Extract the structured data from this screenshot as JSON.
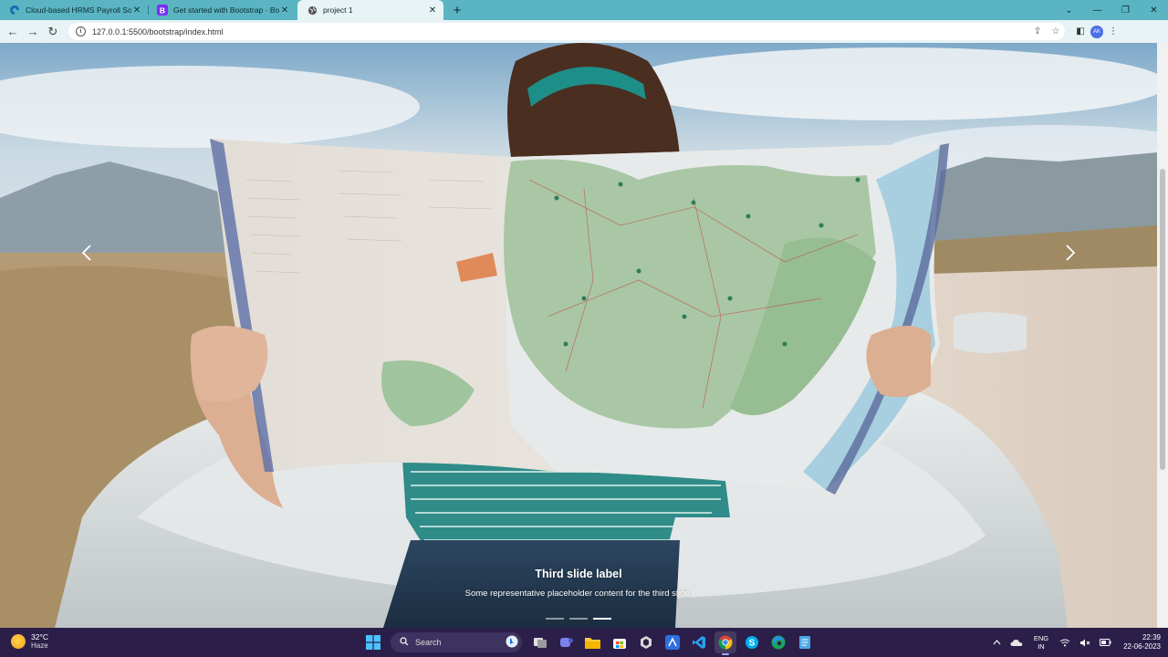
{
  "browser": {
    "tabs": [
      {
        "title": "Cloud-based HRMS Payroll Softw",
        "favicon": "hrms-favicon",
        "active": false
      },
      {
        "title": "Get started with Bootstrap · Boot",
        "favicon": "bootstrap-favicon",
        "active": false
      },
      {
        "title": "project 1",
        "favicon": "globe-favicon",
        "active": true
      }
    ],
    "url": "127.0.0.1:5500/bootstrap/index.html",
    "profile_initials": "AK"
  },
  "carousel": {
    "slide_title": "Third slide label",
    "slide_text": "Some representative placeholder content for the third slide.",
    "indicator_count": 3,
    "active_indicator": 3
  },
  "taskbar": {
    "weather": {
      "temp": "32°C",
      "condition": "Haze"
    },
    "search_placeholder": "Search",
    "language": {
      "line1": "ENG",
      "line2": "IN"
    },
    "clock": {
      "time": "22:39",
      "date": "22-06-2023"
    },
    "apps": [
      "windows-start-icon",
      "search-box",
      "task-view-icon",
      "teams-icon",
      "file-explorer-icon",
      "store-icon",
      "unity-icon",
      "vscode-blue-icon",
      "vscode-icon",
      "chrome-icon",
      "skype-icon",
      "edge-icon",
      "notepad-icon"
    ]
  },
  "colors": {
    "tab_strip": "#5ab4c2",
    "toolbar": "#e7f3f5",
    "taskbar": "#2b1f4a"
  }
}
